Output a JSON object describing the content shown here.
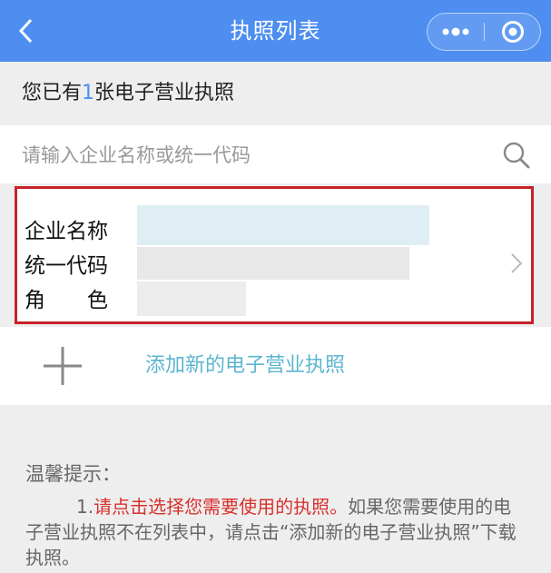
{
  "header": {
    "title": "执照列表",
    "back_icon": "chevron-left-icon",
    "more_icon": "more-dots-icon",
    "close_icon": "target-circle-icon",
    "background": "#4d8ef0"
  },
  "summary": {
    "prefix": "您已有",
    "count": "1",
    "suffix": "张电子营业执照"
  },
  "search": {
    "placeholder": "请输入企业名称或统一代码",
    "value": "",
    "icon": "search-icon"
  },
  "license_card": {
    "label_company": "企业名称",
    "label_code": "统一代码",
    "label_role": "角　　色",
    "border_color": "#c6222a",
    "chevron_icon": "chevron-right-icon"
  },
  "add_license": {
    "label": "添加新的电子营业执照",
    "icon": "plus-icon"
  },
  "tips": {
    "title": "温馨提示：",
    "number": "1.",
    "highlight": "请点击选择您需要使用的执照。",
    "rest": "如果您需要使用的电子营业执照不在列表中，请点击“添加新的电子营业执照”下载执照。"
  }
}
